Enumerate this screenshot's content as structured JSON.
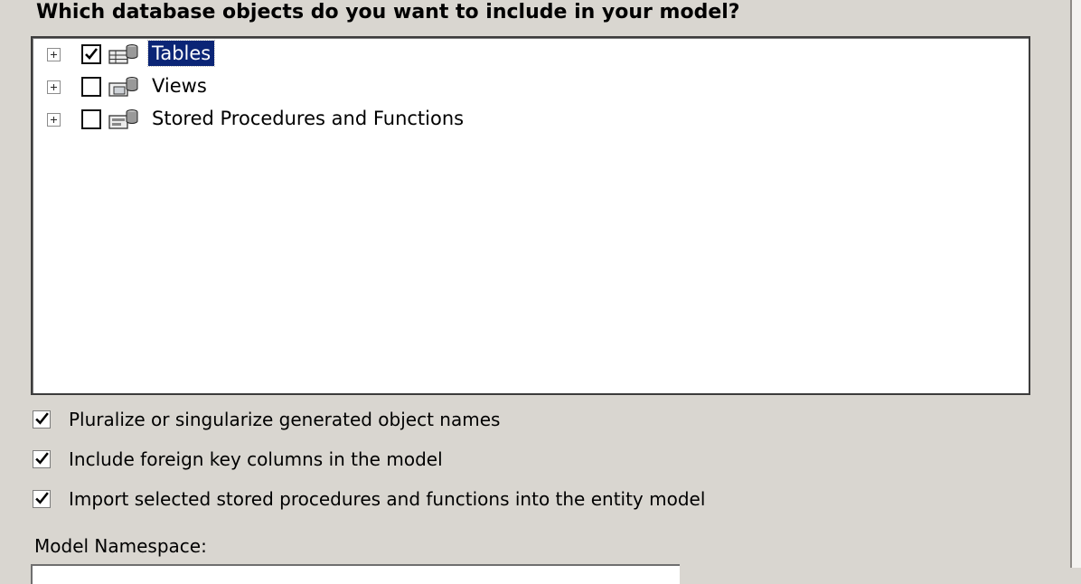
{
  "question": "Which database objects do you want to include in your model?",
  "tree": {
    "items": [
      {
        "label": "Tables",
        "checked": true,
        "expanded": false,
        "selected": true,
        "icon": "tables-icon"
      },
      {
        "label": "Views",
        "checked": false,
        "expanded": false,
        "selected": false,
        "icon": "views-icon"
      },
      {
        "label": "Stored Procedures and Functions",
        "checked": false,
        "expanded": false,
        "selected": false,
        "icon": "stored-procedures-icon"
      }
    ]
  },
  "options": {
    "pluralize": {
      "label": "Pluralize or singularize generated object names",
      "checked": true
    },
    "foreign_keys": {
      "label": "Include foreign key columns in the model",
      "checked": true
    },
    "import_procs": {
      "label": "Import selected stored procedures and functions into the entity model",
      "checked": true
    }
  },
  "namespace": {
    "label": "Model Namespace:",
    "value": ""
  },
  "colors": {
    "dialog_bg": "#d9d6d0",
    "selection_bg": "#0b2576",
    "selection_fg": "#ffffff"
  }
}
